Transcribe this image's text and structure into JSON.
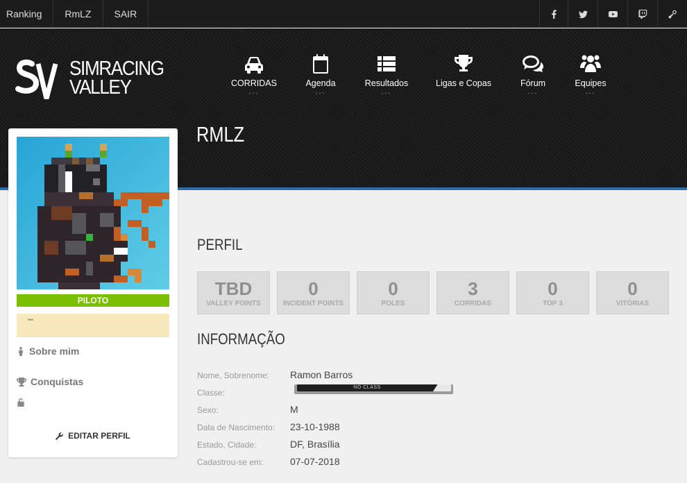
{
  "topbar": {
    "links": [
      "Ranking",
      "RmLZ",
      "SAIR"
    ],
    "social": [
      "facebook-icon",
      "twitter-icon",
      "youtube-icon",
      "twitch-icon",
      "steam-icon"
    ]
  },
  "logo": {
    "line1": "SIMRACING",
    "line2": "VALLEY"
  },
  "nav": [
    {
      "label": "CORRIDAS",
      "icon": "car-icon"
    },
    {
      "label": "Agenda",
      "icon": "calendar-icon"
    },
    {
      "label": "Resultados",
      "icon": "list-icon"
    },
    {
      "label": "Ligas e Copas",
      "icon": "trophy-icon"
    },
    {
      "label": "Fórum",
      "icon": "comments-icon"
    },
    {
      "label": "Equipes",
      "icon": "users-icon"
    }
  ],
  "page": {
    "title": "RMLZ"
  },
  "sidebar": {
    "badge": "PILOTO",
    "quote": "\"\"",
    "about": "Sobre mim",
    "achievements": "Conquistas",
    "edit": "EDITAR PERFIL"
  },
  "profile": {
    "section_title": "PERFIL",
    "stats": [
      {
        "value": "TBD",
        "label": "VALLEY POINTS"
      },
      {
        "value": "0",
        "label": "INCIDENT POINTS"
      },
      {
        "value": "0",
        "label": "POLES"
      },
      {
        "value": "3",
        "label": "CORRIDAS"
      },
      {
        "value": "0",
        "label": "TOP 3"
      },
      {
        "value": "0",
        "label": "VITÓRIAS"
      }
    ]
  },
  "info": {
    "section_title": "INFORMAÇÃO",
    "rows": [
      {
        "key": "Nome, Sobrenome:",
        "value": "Ramon Barros"
      },
      {
        "key": "Classe:",
        "value": "NO CLASS"
      },
      {
        "key": "Sexo:",
        "value": "M"
      },
      {
        "key": "Data de Nascimento:",
        "value": "23-10-1988"
      },
      {
        "key": "Estado, Cidade:",
        "value": "DF, Brasília"
      },
      {
        "key": "Cadastrou-se em:",
        "value": "07-07-2018"
      }
    ]
  },
  "colors": {
    "accent_blue": "#2d6da3",
    "badge_green": "#7ac000",
    "header_bg": "#141414"
  }
}
